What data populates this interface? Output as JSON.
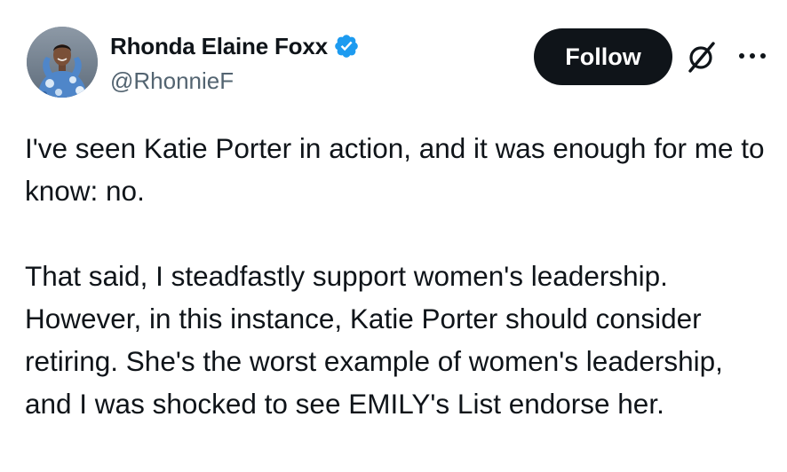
{
  "author": {
    "display_name": "Rhonda Elaine Foxx",
    "handle": "@RhonnieF",
    "verified": true
  },
  "actions": {
    "follow_label": "Follow",
    "grok_icon": "grok-icon",
    "more_icon": "more-options-icon"
  },
  "tweet": {
    "paragraph_1": "I've seen Katie Porter in action, and it was enough for me to know: no.",
    "paragraph_2": "That said, I steadfastly support women's leadership. However, in this instance, Katie Porter should consider retiring. She's the worst example of women's leadership, and I was shocked to see EMILY's List endorse her."
  },
  "colors": {
    "text": "#0f1419",
    "secondary_text": "#536471",
    "verified_badge": "#1d9bf0",
    "follow_button_bg": "#0f1419",
    "follow_button_text": "#ffffff"
  }
}
